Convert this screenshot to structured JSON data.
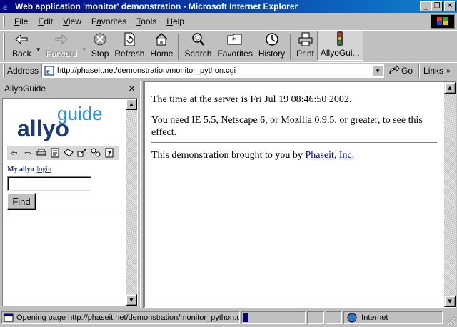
{
  "window": {
    "title": "Web application 'monitor' demonstration - Microsoft Internet Explorer",
    "minimize": "_",
    "restore": "❐",
    "close": "✕"
  },
  "menu": [
    "File",
    "Edit",
    "View",
    "Favorites",
    "Tools",
    "Help"
  ],
  "menu_access_keys": [
    "F",
    "E",
    "V",
    "a",
    "T",
    "H"
  ],
  "toolbar": {
    "back": "Back",
    "forward": "Forward",
    "stop": "Stop",
    "refresh": "Refresh",
    "home": "Home",
    "search": "Search",
    "favorites": "Favorites",
    "history": "History",
    "print": "Print",
    "allyoguide": "AllyoGui..."
  },
  "address": {
    "label": "Address",
    "url": "http://phaseit.net/demonstration/monitor_python.cgi",
    "go": "Go",
    "links": "Links"
  },
  "explorer": {
    "title": "AllyoGuide",
    "close": "×",
    "logo_top": "guide",
    "logo_bottom": "allyo",
    "my_allyo": "My allyo",
    "login": "login",
    "search_value": "",
    "find": "Find"
  },
  "content": {
    "line1": "The time at the server is Fri Jul 19 08:46:50 2002.",
    "line2": "You need IE 5.5, Netscape 6, or Mozilla 0.9.5, or greater, to see this effect.",
    "line3_prefix": "This demonstration brought to you by ",
    "line3_link": "Phaseit, Inc.",
    "line3_suffix": ""
  },
  "status": {
    "text": "Opening page http://phaseit.net/demonstration/monitor_python.cgi...",
    "progress": 0.08,
    "zone": "Internet"
  },
  "colors": {
    "titlebar_start": "#000080",
    "titlebar_end": "#1084d0",
    "chrome": "#c0c0c0",
    "link": "#00008b",
    "allyo_blue": "#1e3a78",
    "guide_blue": "#2c8ad0"
  }
}
